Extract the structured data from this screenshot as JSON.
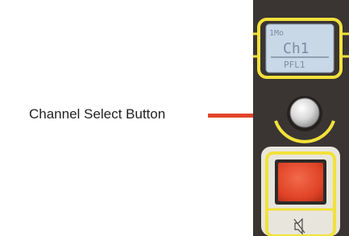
{
  "callout": {
    "label": "Channel Select Button",
    "line_color": "#e3452a"
  },
  "display": {
    "mode": "1Mo",
    "channel": "Ch1",
    "pfl": "PFL1"
  },
  "buttons": {
    "select_icon": "round-select-button",
    "on_icon": "red-square-on-button",
    "mute_icon": "speaker-mute-icon"
  },
  "colors": {
    "panel": "#3a3533",
    "accent_yellow": "#f2e13a",
    "lcd_bg": "#c9d8e6",
    "lcd_text": "#7d8da0",
    "red_button": "#e94a2d"
  }
}
